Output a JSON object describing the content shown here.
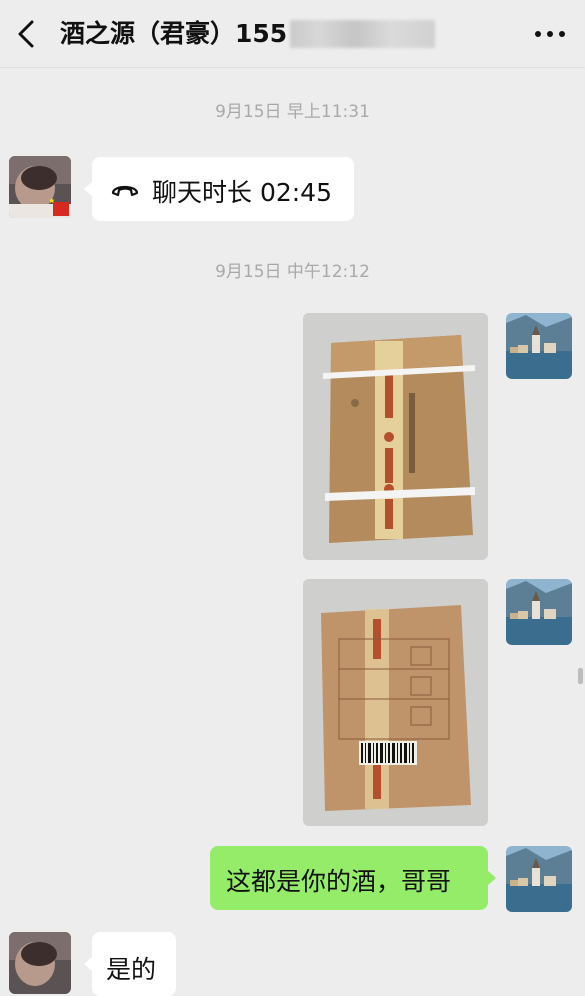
{
  "header": {
    "title": "酒之源（君豪）155",
    "back_icon": "chevron-left-icon",
    "more_icon": "more-dots-icon"
  },
  "messages": {
    "timestamp_1": "9月15日 早上11:31",
    "call_text": "聊天时长 02:45",
    "call_icon": "phone-hangup-icon",
    "timestamp_2": "9月15日 中午12:12",
    "sent_text": "这都是你的酒，哥哥",
    "reply_text": "是的"
  },
  "colors": {
    "background": "#ededed",
    "sent_bubble": "#95ec69",
    "received_bubble": "#ffffff",
    "timestamp": "#a9a9a9"
  }
}
